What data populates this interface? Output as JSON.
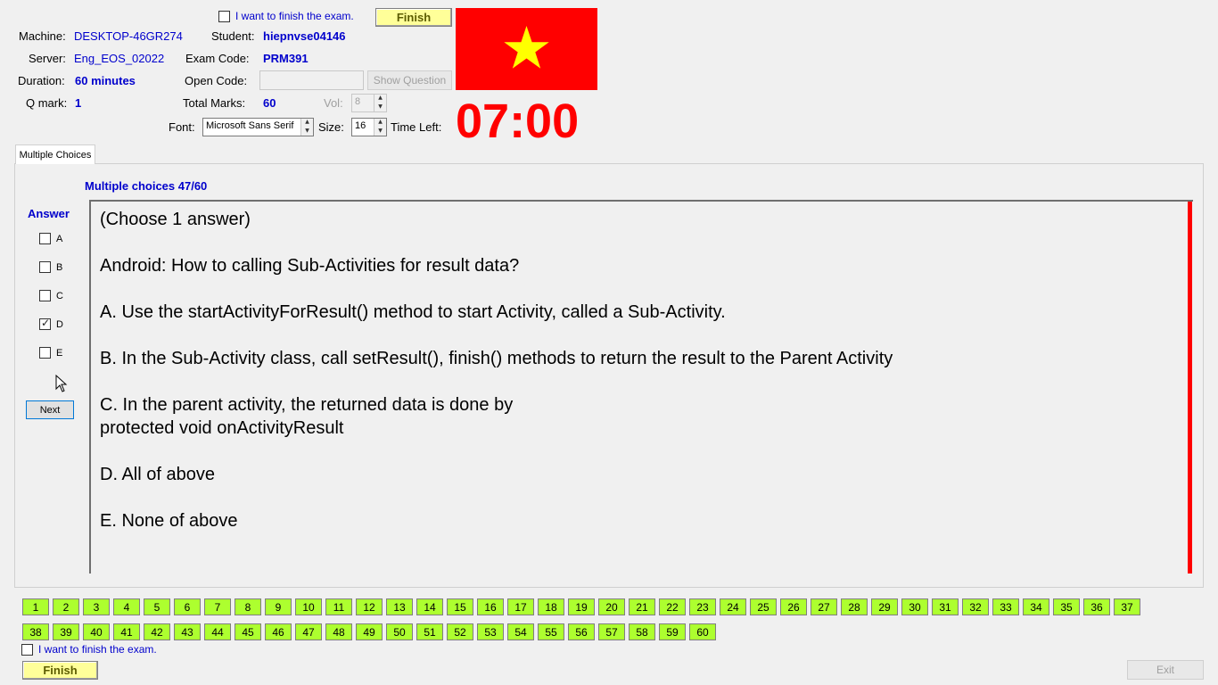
{
  "header": {
    "finish_check_label": "I want to finish the exam.",
    "finish_button": "Finish",
    "machine_label": "Machine:",
    "machine_value": "DESKTOP-46GR274",
    "student_label": "Student:",
    "student_value": "hiepnvse04146",
    "server_label": "Server:",
    "server_value": "Eng_EOS_02022",
    "exam_code_label": "Exam Code:",
    "exam_code_value": "PRM391",
    "duration_label": "Duration:",
    "duration_value": "60 minutes",
    "open_code_label": "Open Code:",
    "open_code_value": "",
    "show_question_button": "Show Question",
    "qmark_label": "Q mark:",
    "qmark_value": "1",
    "total_marks_label": "Total Marks:",
    "total_marks_value": "60",
    "vol_label": "Vol:",
    "vol_value": "8",
    "font_label": "Font:",
    "font_value": "Microsoft Sans Serif",
    "size_label": "Size:",
    "size_value": "16",
    "time_left_label": "Time Left:",
    "time_left_value": "07:00"
  },
  "flag": {
    "background": "#ff0000",
    "star": "#ffff00"
  },
  "tab": {
    "label": "Multiple Choices"
  },
  "question": {
    "counter": "Multiple choices 47/60",
    "answer_heading": "Answer",
    "options": [
      {
        "label": "A",
        "checked": false
      },
      {
        "label": "B",
        "checked": false
      },
      {
        "label": "C",
        "checked": false
      },
      {
        "label": "D",
        "checked": true
      },
      {
        "label": "E",
        "checked": false
      }
    ],
    "next_button": "Next",
    "text": "(Choose 1 answer)\n\nAndroid: How to calling Sub-Activities for result data?\n\nA.  Use the startActivityForResult() method to start Activity, called a Sub-Activity.\n\nB.  In the Sub-Activity class, call setResult(), finish() methods to return the result to the Parent Activity\n\nC.  In the parent activity, the returned data is done by\nprotected void onActivityResult\n\nD.  All of above\n\nE.  None of above"
  },
  "question_buttons": [
    "1",
    "2",
    "3",
    "4",
    "5",
    "6",
    "7",
    "8",
    "9",
    "10",
    "11",
    "12",
    "13",
    "14",
    "15",
    "16",
    "17",
    "18",
    "19",
    "20",
    "21",
    "22",
    "23",
    "24",
    "25",
    "26",
    "27",
    "28",
    "29",
    "30",
    "31",
    "32",
    "33",
    "34",
    "35",
    "36",
    "37",
    "38",
    "39",
    "40",
    "41",
    "42",
    "43",
    "44",
    "45",
    "46",
    "47",
    "48",
    "49",
    "50",
    "51",
    "52",
    "53",
    "54",
    "55",
    "56",
    "57",
    "58",
    "59",
    "60"
  ],
  "footer": {
    "finish_check_label": "I want to finish the exam.",
    "finish_button": "Finish",
    "exit_button": "Exit"
  },
  "colors": {
    "question_button": "#adff2f",
    "timer": "#ff0000",
    "accent_text": "#0000cc",
    "scroll_marker": "#ff0000"
  }
}
